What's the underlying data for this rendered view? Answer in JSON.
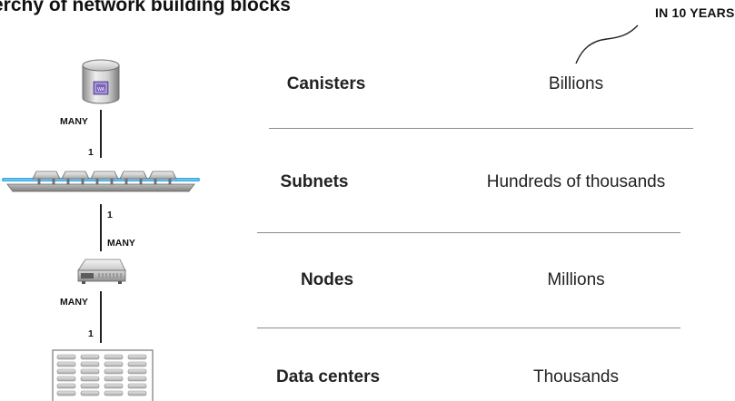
{
  "title": "erchy of network building blocks",
  "column_header": "IN 10 YEARS",
  "rows": [
    {
      "name": "Canisters",
      "value": "Billions"
    },
    {
      "name": "Subnets",
      "value": "Hundreds of thousands"
    },
    {
      "name": "Nodes",
      "value": "Millions"
    },
    {
      "name": "Data centers",
      "value": "Thousands"
    }
  ],
  "relations": [
    {
      "top": "MANY",
      "bottom": "1"
    },
    {
      "top": "1",
      "bottom": "MANY"
    },
    {
      "top": "MANY",
      "bottom": "1"
    }
  ],
  "icons": {
    "canister": "database-canister-icon",
    "canister_label": "WA",
    "subnet": "subnet-network-icon",
    "node": "server-node-icon",
    "datacenter": "datacenter-racks-icon"
  },
  "colors": {
    "canister_label_bg": "#7b63b8",
    "subnet_link": "#36a9e0",
    "separator": "#8a8a8a"
  }
}
